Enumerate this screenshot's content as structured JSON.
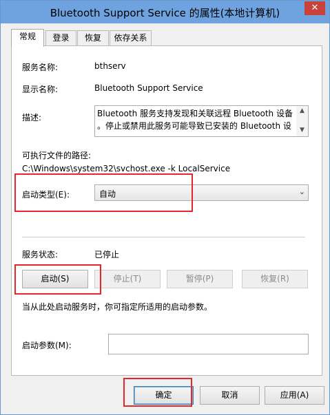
{
  "window": {
    "title": "Bluetooth Support Service 的属性(本地计算机)",
    "close_glyph": "✕"
  },
  "tabs": [
    {
      "label": "常规",
      "active": true
    },
    {
      "label": "登录",
      "active": false
    },
    {
      "label": "恢复",
      "active": false
    },
    {
      "label": "依存关系",
      "active": false
    }
  ],
  "general": {
    "service_name_label": "服务名称:",
    "service_name_value": "bthserv",
    "display_name_label": "显示名称:",
    "display_name_value": "Bluetooth Support Service",
    "description_label": "描述:",
    "description_text": "Bluetooth 服务支持发现和关联远程 Bluetooth 设备\n。停止或禁用此服务可能导致已安装的 Bluetooth 设",
    "exe_path_label": "可执行文件的路径:",
    "exe_path_value": "C:\\Windows\\system32\\svchost.exe -k LocalService",
    "startup_type_label": "启动类型(E):",
    "startup_type_value": "自动",
    "service_status_label": "服务状态:",
    "service_status_value": "已停止",
    "start_button": "启动(S)",
    "stop_button": "停止(T)",
    "pause_button": "暂停(P)",
    "resume_button": "恢复(R)",
    "hint_text": "当从此处启动服务时，你可指定所适用的启动参数。",
    "start_params_label": "启动参数(M):",
    "start_params_value": ""
  },
  "footer": {
    "ok_button": "确定",
    "cancel_button": "取消",
    "apply_button": "应用(A)"
  },
  "icons": {
    "scroll_up": "▲",
    "scroll_down": "▼",
    "dropdown": "⌄"
  },
  "colors": {
    "titlebar": "#6fa3e0",
    "close_button": "#c7423a",
    "highlight_box": "#e2262b"
  }
}
